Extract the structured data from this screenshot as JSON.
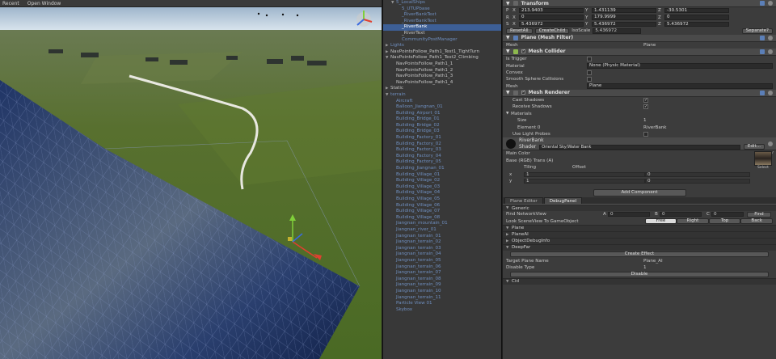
{
  "scene": {
    "toolbar": {
      "left": "Recent",
      "right": "Open Window"
    }
  },
  "hierarchy": {
    "rows": [
      {
        "label": "5_LocalShips",
        "depth": 1,
        "style": "blue",
        "tri": "▼"
      },
      {
        "label": "5_UTUPbase",
        "depth": 2,
        "style": "blue",
        "tri": ""
      },
      {
        "label": "_RiverBankText",
        "depth": 2,
        "style": "blue",
        "tri": ""
      },
      {
        "label": "_RiverBankText",
        "depth": 2,
        "style": "blue",
        "tri": ""
      },
      {
        "label": "_RiverBank",
        "depth": 2,
        "style": "sel",
        "tri": ""
      },
      {
        "label": "_RiverText",
        "depth": 2,
        "style": "",
        "tri": ""
      },
      {
        "label": "CommunityPostManager",
        "depth": 2,
        "style": "blue",
        "tri": ""
      },
      {
        "label": "Lights",
        "depth": 0,
        "style": "blue",
        "tri": "▶"
      },
      {
        "label": "NavPointsFollow_Path1_Test1_TightTurn",
        "depth": 0,
        "style": "",
        "tri": "▶"
      },
      {
        "label": "NavPointsFollow_Path1_Test2_Climbing",
        "depth": 0,
        "style": "",
        "tri": "▼"
      },
      {
        "label": "NavPointsFollow_Path1_1",
        "depth": 1,
        "style": "",
        "tri": ""
      },
      {
        "label": "NavPointsFollow_Path1_2",
        "depth": 1,
        "style": "",
        "tri": ""
      },
      {
        "label": "NavPointsFollow_Path1_3",
        "depth": 1,
        "style": "",
        "tri": ""
      },
      {
        "label": "NavPointsFollow_Path1_4",
        "depth": 1,
        "style": "",
        "tri": ""
      },
      {
        "label": "Static",
        "depth": 0,
        "style": "",
        "tri": "▶"
      },
      {
        "label": "terrain",
        "depth": 0,
        "style": "blue",
        "tri": "▼"
      },
      {
        "label": "Aircraft",
        "depth": 1,
        "style": "blue",
        "tri": ""
      },
      {
        "label": "Balloon_Jiangnan_01",
        "depth": 1,
        "style": "blue",
        "tri": ""
      },
      {
        "label": "Building_Airport_01",
        "depth": 1,
        "style": "blue",
        "tri": ""
      },
      {
        "label": "Building_Bridge_01",
        "depth": 1,
        "style": "blue",
        "tri": ""
      },
      {
        "label": "Building_Bridge_02",
        "depth": 1,
        "style": "blue",
        "tri": ""
      },
      {
        "label": "Building_Bridge_03",
        "depth": 1,
        "style": "blue",
        "tri": ""
      },
      {
        "label": "Building_Factory_01",
        "depth": 1,
        "style": "blue",
        "tri": ""
      },
      {
        "label": "Building_Factory_02",
        "depth": 1,
        "style": "blue",
        "tri": ""
      },
      {
        "label": "Building_Factory_03",
        "depth": 1,
        "style": "blue",
        "tri": ""
      },
      {
        "label": "Building_Factory_04",
        "depth": 1,
        "style": "blue",
        "tri": ""
      },
      {
        "label": "Building_Factory_05",
        "depth": 1,
        "style": "blue",
        "tri": ""
      },
      {
        "label": "Building_Jiangnan_01",
        "depth": 1,
        "style": "blue",
        "tri": ""
      },
      {
        "label": "Building_Village_01",
        "depth": 1,
        "style": "blue",
        "tri": ""
      },
      {
        "label": "Building_Village_02",
        "depth": 1,
        "style": "blue",
        "tri": ""
      },
      {
        "label": "Building_Village_03",
        "depth": 1,
        "style": "blue",
        "tri": ""
      },
      {
        "label": "Building_Village_04",
        "depth": 1,
        "style": "blue",
        "tri": ""
      },
      {
        "label": "Building_Village_05",
        "depth": 1,
        "style": "blue",
        "tri": ""
      },
      {
        "label": "Building_Village_06",
        "depth": 1,
        "style": "blue",
        "tri": ""
      },
      {
        "label": "Building_Village_07",
        "depth": 1,
        "style": "blue",
        "tri": ""
      },
      {
        "label": "Building_Village_08",
        "depth": 1,
        "style": "blue",
        "tri": ""
      },
      {
        "label": "Jiangnan_mountain_01",
        "depth": 1,
        "style": "blue",
        "tri": ""
      },
      {
        "label": "Jiangnan_river_01",
        "depth": 1,
        "style": "blue",
        "tri": ""
      },
      {
        "label": "Jiangnan_terrain_01",
        "depth": 1,
        "style": "blue",
        "tri": ""
      },
      {
        "label": "Jiangnan_terrain_02",
        "depth": 1,
        "style": "blue",
        "tri": ""
      },
      {
        "label": "Jiangnan_terrain_03",
        "depth": 1,
        "style": "blue",
        "tri": ""
      },
      {
        "label": "Jiangnan_terrain_04",
        "depth": 1,
        "style": "blue",
        "tri": ""
      },
      {
        "label": "Jiangnan_terrain_05",
        "depth": 1,
        "style": "blue",
        "tri": ""
      },
      {
        "label": "Jiangnan_terrain_06",
        "depth": 1,
        "style": "blue",
        "tri": ""
      },
      {
        "label": "Jiangnan_terrain_07",
        "depth": 1,
        "style": "blue",
        "tri": ""
      },
      {
        "label": "Jiangnan_terrain_08",
        "depth": 1,
        "style": "blue",
        "tri": ""
      },
      {
        "label": "Jiangnan_terrain_09",
        "depth": 1,
        "style": "blue",
        "tri": ""
      },
      {
        "label": "Jiangnan_terrain_10",
        "depth": 1,
        "style": "blue",
        "tri": ""
      },
      {
        "label": "Jiangnan_terrain_11",
        "depth": 1,
        "style": "blue",
        "tri": ""
      },
      {
        "label": "Particle View 01",
        "depth": 1,
        "style": "blue",
        "tri": ""
      },
      {
        "label": "Skybox",
        "depth": 1,
        "style": "blue",
        "tri": ""
      }
    ]
  },
  "inspector": {
    "transform": {
      "title": "Transform",
      "position": {
        "x": "213.9403",
        "y": "1.431139",
        "z": "-30.5301"
      },
      "rotation": {
        "x": "0",
        "y": "179.9999",
        "z": "0"
      },
      "scale": {
        "x": "5.436972",
        "y": "5.436972",
        "z": "5.436972"
      },
      "reset_all": "ResetAll",
      "create_child": "CreateChild",
      "iso_scale_label": "IsoScale",
      "iso_scale_value": "5.436972",
      "separate": "Separate?"
    },
    "mesh_filter": {
      "title": "Plane (Mesh Filter)",
      "mesh_label": "Mesh",
      "mesh_value": "Plane"
    },
    "mesh_collider": {
      "title": "Mesh Collider",
      "is_trigger": "Is Trigger",
      "material": "Material",
      "material_value": "None (Physic Material)",
      "convex": "Convex",
      "smooth": "Smooth Sphere Collisions",
      "mesh": "Mesh",
      "mesh_value": "Plane"
    },
    "mesh_renderer": {
      "title": "Mesh Renderer",
      "cast_shadows": "Cast Shadows",
      "receive_shadows": "Receive Shadows",
      "materials": "Materials",
      "size": "Size",
      "size_value": "1",
      "element0": "Element 0",
      "element0_value": "RiverBank",
      "light_probes": "Use Light Probes"
    },
    "material": {
      "name": "RiverBank",
      "shader_label": "Shader",
      "shader_value": "Oriental Sky/Water Bank",
      "edit": "Edit...",
      "main_color": "Main Color",
      "base": "Base (RGB) Trans (A)",
      "tiling": "Tiling",
      "offset": "Offset",
      "x": "x",
      "y": "y",
      "tx": "1",
      "ty": "1",
      "ox": "0",
      "oy": "0",
      "select": "Select",
      "white": "#ffffff"
    },
    "add_component": "Add Component",
    "tabs": [
      "Plane Editor",
      "DebugPanel"
    ],
    "plane_editor": {
      "generic": "Generic",
      "find_network_view": "Find NetworkView",
      "a_label": "A",
      "a_val": "0",
      "b_label": "B",
      "b_val": "0",
      "c_label": "C",
      "c_val": "0",
      "find": "Find",
      "look_label": "Look SceneView To GameObject",
      "look_buttons": [
        "Free",
        "Right",
        "Top",
        "Back"
      ],
      "sections": [
        "Plane",
        "PlaneAI",
        "ObjectDebugInfo",
        "DeepFar"
      ],
      "create_effect": "Create Effect",
      "target_plane": "Target Plane Name",
      "target_value": "Plane_AI",
      "disable_type": "Disable Type",
      "disable_type_value": "1",
      "disable": "Disable",
      "cid": "Cid"
    }
  },
  "colors": {
    "selection": "#3d5f96",
    "panel": "#3c3c3c",
    "grass": "#4d6b2a",
    "water": "#1c2f55"
  }
}
